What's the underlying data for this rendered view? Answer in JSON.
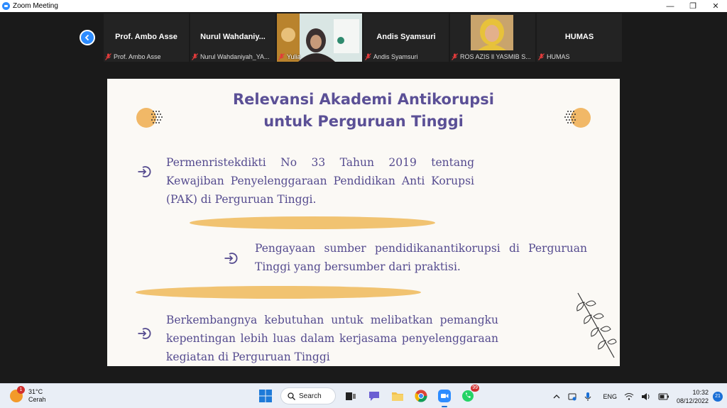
{
  "window": {
    "title": "Zoom Meeting",
    "controls": [
      "—",
      "❐",
      "✕"
    ]
  },
  "participants": [
    {
      "display_name": "Prof. Ambo Asse",
      "label": "Prof. Ambo Asse",
      "video": false
    },
    {
      "display_name": "Nurul  Wahdaniy...",
      "label": "Nurul Wahdaniyah_YA...",
      "video": false
    },
    {
      "display_name": "",
      "label": "Yulia",
      "video": true
    },
    {
      "display_name": "Andis Syamsuri",
      "label": "Andis Syamsuri",
      "video": false
    },
    {
      "display_name": "",
      "label": "ROS AZIS ll YASMIB S...",
      "video": true
    },
    {
      "display_name": "HUMAS",
      "label": "HUMAS",
      "video": false
    }
  ],
  "slide": {
    "title_line1": "Relevansi Akademi Antikorupsi",
    "title_line2": "untuk Perguruan Tinggi",
    "point1": "Permenristekdikti No 33 Tahun 2019 tentang Kewajiban Penyelenggaraan Pendidikan Anti Korupsi (PAK) di Perguruan Tinggi.",
    "point2": "Pengayaan sumber pendidikanantikorupsi di Perguruan Tinggi yang bersumber dari praktisi.",
    "point3": "Berkembangnya kebutuhan untuk melibatkan pemangku kepentingan lebih luas dalam kerjasama penyelenggaraan kegiatan di Perguruan Tinggi",
    "accent_color": "#5b5096",
    "stripe_color": "#f1c371"
  },
  "taskbar": {
    "weather_temp": "31°C",
    "weather_desc": "Cerah",
    "weather_badge": "1",
    "search_label": "Search",
    "whatsapp_badge": "99",
    "language": "ENG",
    "time": "10:32",
    "date": "08/12/2022",
    "notifications": "21"
  }
}
